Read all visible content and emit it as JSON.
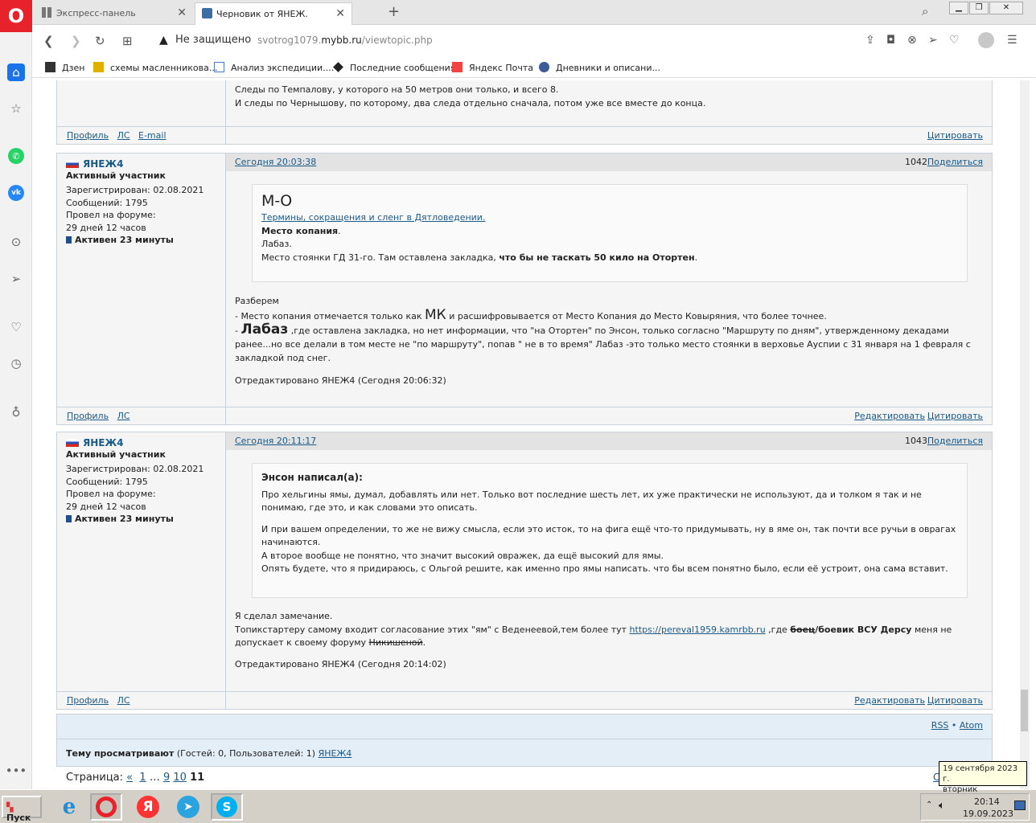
{
  "browser": {
    "logo": "O",
    "tabs": [
      {
        "label": "Экспресс-панель",
        "active": false
      },
      {
        "label": "Черновик от ЯНЕЖ.",
        "active": true
      }
    ],
    "address": {
      "security_label": "Не защищено",
      "url_prefix": "svotrog1079.",
      "url_domain": "mybb.ru",
      "url_path": "/viewtopic.php"
    },
    "bookmarks": [
      {
        "label": "Дзен",
        "icon": "document-icon"
      },
      {
        "label": "схемы масленникова...",
        "icon": "map-icon"
      },
      {
        "label": "Анализ экспедиции....",
        "icon": "file-icon"
      },
      {
        "label": "Последние сообщения",
        "icon": "diamond-icon"
      },
      {
        "label": "Яндекс Почта",
        "icon": "mail-icon"
      },
      {
        "label": "Дневники и описани...",
        "icon": "forward-icon"
      }
    ]
  },
  "post_top": {
    "lines": [
      "Следы по Темпалову, у которого на 50 метров они только, и всего 8.",
      "И следы по Чернышову, по которому, два следа отдельно сначала, потом уже все вместе до конца."
    ],
    "footer_links": [
      "Профиль",
      "ЛС",
      "E-mail"
    ],
    "quote_link": "Цитировать"
  },
  "post_1042": {
    "author": "ЯНЕЖ4",
    "rank": "Активный участник",
    "registered": "Зарегистрирован: 02.08.2021",
    "messages": "Сообщений: 1795",
    "time_label": "Провел на форуме:",
    "time_value": "29 дней 12 часов",
    "active": "Активен 23 минуты",
    "date": "Сегодня 20:03:38",
    "number": "1042",
    "share": "Поделиться",
    "quote": {
      "title": "М-О",
      "link": "Термины, сокращения и сленг в Дятловедении.",
      "term": "Место копания",
      "term_dot": ".",
      "line1": "Лабаз.",
      "line2_pre": "Место стоянки ГД 31-го. Там оставлена закладка, ",
      "line2_bold": "что бы не таскать 50 кило на Отортен",
      "line2_post": "."
    },
    "body": {
      "p1": "Разберем",
      "l1_pre": "- Место копания отмечается только как ",
      "l1_big": "МК",
      "l1_post": " и расшифровывается от Место Копания до Место Ковыряния, что более точнее.",
      "l2_pre": "- ",
      "l2_big": "Лабаз",
      "l2_post": " ,где оставлена  закладка, но нет информации, что \"на Отортен\" по Энсон, только согласно \"Маршруту по дням\", утвержденному  декадами ранее...но все делали в том месте не \"по маршруту\", попав \" не в то время\" Лабаз -это только место стоянки  в верховье Ауспии с 31 января на 1 февраля с закладкой под снег.",
      "edited": "Отредактировано ЯНЕЖ4 (Сегодня 20:06:32)"
    },
    "footer_links": [
      "Профиль",
      "ЛС"
    ],
    "edit": "Редактировать",
    "quote_link": "Цитировать"
  },
  "post_1043": {
    "author": "ЯНЕЖ4",
    "rank": "Активный участник",
    "registered": "Зарегистрирован: 02.08.2021",
    "messages": "Сообщений: 1795",
    "time_label": "Провел на форуме:",
    "time_value": "29 дней 12 часов",
    "active": "Активен 23 минуты",
    "date": "Сегодня 20:11:17",
    "number": "1043",
    "share": "Поделиться",
    "quote": {
      "title": "Энсон написал(а):",
      "p1": "Про хельгины ямы, думал, добавлять или нет. Только вот последние шесть лет, их уже практически не используют, да и толком я так и не понимаю, где это, и как словами это описать.",
      "p2": "И при вашем определении, то же не вижу смысла, если это исток, то на фига ещё что-то придумывать, ну в яме он, так почти все ручьи в оврагах начинаются.",
      "p3": "А второе вообще не понятно, что значит высокий овражек, да ещё высокий для ямы.",
      "p4": "Опять будете, что я придираюсь, с Ольгой решите, как именно про ямы написать. что бы всем понятно было, если её устроит, она сама вставит."
    },
    "body": {
      "l1": "Я сделал замечание.",
      "l2_pre": "Топикстартеру самому входит согласование этих \"ям\" с Веденеевой,тем более тут ",
      "l2_link": "https://pereval1959.kamrbb.ru",
      "l2_mid": " ,где ",
      "l2_strike_bold": "боец",
      "l2_bold": "/боевик ВСУ Дерсу",
      "l2_post": " меня не",
      "l3_pre": "допускает  к своему форуму ",
      "l3_strike": "Никишеной",
      "l3_post": ".",
      "edited": "Отредактировано ЯНЕЖ4 (Сегодня 20:14:02)"
    },
    "footer_links": [
      "Профиль",
      "ЛС"
    ],
    "edit": "Редактировать",
    "quote_link": "Цитировать"
  },
  "feeds": {
    "rss": "RSS",
    "sep": "•",
    "atom": "Atom"
  },
  "viewers": {
    "label": "Тему просматривают",
    "text": " (Гостей: 0, Пользователей: 1) ",
    "user": "ЯНЕЖ4"
  },
  "pagination": {
    "label": "Страница:",
    "prev": "«",
    "p1": "1",
    "dots": "…",
    "p9": "9",
    "p10": "10",
    "current": "11",
    "cut": "С"
  },
  "taskbar": {
    "start": "Пуск",
    "clock_time": "20:14",
    "clock_date": "19.09.2023",
    "tooltip_date": "19 сентября 2023 г.",
    "tooltip_day": "вторник"
  },
  "colors": {
    "opera_red": "#e8222a",
    "link": "#1a5a8a",
    "post_bg": "#f5f5f5",
    "header_bg": "#e3e3e3"
  }
}
